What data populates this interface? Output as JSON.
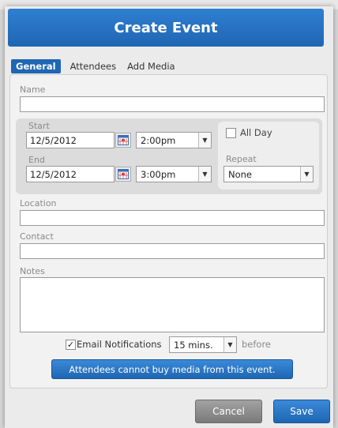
{
  "dialog": {
    "title": "Create Event"
  },
  "tabs": [
    {
      "label": "General",
      "active": true
    },
    {
      "label": "Attendees",
      "active": false
    },
    {
      "label": "Add Media",
      "active": false
    }
  ],
  "form": {
    "name_label": "Name",
    "name_value": "",
    "start_label": "Start",
    "start_date": "12/5/2012",
    "start_time": "2:00pm",
    "end_label": "End",
    "end_date": "12/5/2012",
    "end_time": "3:00pm",
    "all_day_label": "All Day",
    "all_day_checked": false,
    "repeat_label": "Repeat",
    "repeat_value": "None",
    "location_label": "Location",
    "location_value": "",
    "contact_label": "Contact",
    "contact_value": "",
    "notes_label": "Notes",
    "notes_value": "",
    "email_notifications_label": "Email Notifications",
    "email_notifications_checked": true,
    "notify_value": "15 mins.",
    "before_label": "before"
  },
  "media_button": {
    "label": "Attendees cannot buy media from this event."
  },
  "footer": {
    "cancel_label": "Cancel",
    "save_label": "Save"
  },
  "colors": {
    "accent": "#1f66b3",
    "cancel": "#8a8a8a"
  },
  "icons": {
    "calendar": "calendar-icon",
    "dropdown": "chevron-down-icon",
    "check": "checkmark-icon"
  }
}
